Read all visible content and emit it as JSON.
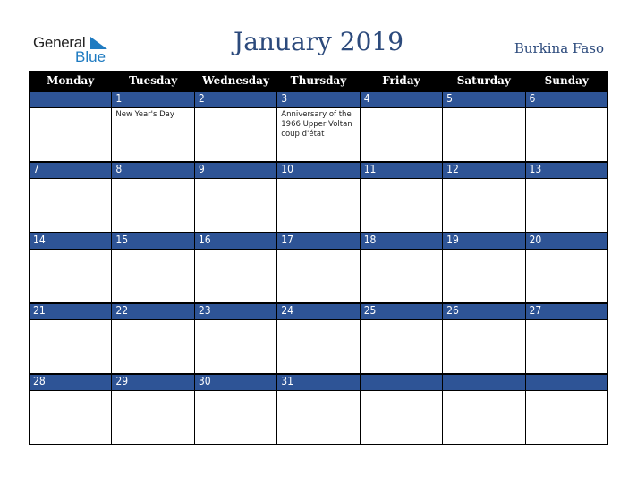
{
  "logo": {
    "line1": "General",
    "line2": "Blue"
  },
  "header": {
    "title": "January 2019",
    "country": "Burkina Faso"
  },
  "weekdays": [
    "Monday",
    "Tuesday",
    "Wednesday",
    "Thursday",
    "Friday",
    "Saturday",
    "Sunday"
  ],
  "weeks": [
    {
      "days": [
        "",
        "1",
        "2",
        "3",
        "4",
        "5",
        "6"
      ],
      "events": [
        "",
        "New Year's Day",
        "",
        "Anniversary of the 1966 Upper Voltan coup d'état",
        "",
        "",
        ""
      ]
    },
    {
      "days": [
        "7",
        "8",
        "9",
        "10",
        "11",
        "12",
        "13"
      ],
      "events": [
        "",
        "",
        "",
        "",
        "",
        "",
        ""
      ]
    },
    {
      "days": [
        "14",
        "15",
        "16",
        "17",
        "18",
        "19",
        "20"
      ],
      "events": [
        "",
        "",
        "",
        "",
        "",
        "",
        ""
      ]
    },
    {
      "days": [
        "21",
        "22",
        "23",
        "24",
        "25",
        "26",
        "27"
      ],
      "events": [
        "",
        "",
        "",
        "",
        "",
        "",
        ""
      ]
    },
    {
      "days": [
        "28",
        "29",
        "30",
        "31",
        "",
        "",
        ""
      ],
      "events": [
        "",
        "",
        "",
        "",
        "",
        "",
        ""
      ]
    }
  ],
  "colors": {
    "accent": "#2e5496",
    "title": "#2c4a7c",
    "logo_blue": "#1f7bc1",
    "header_bg": "#000000"
  }
}
